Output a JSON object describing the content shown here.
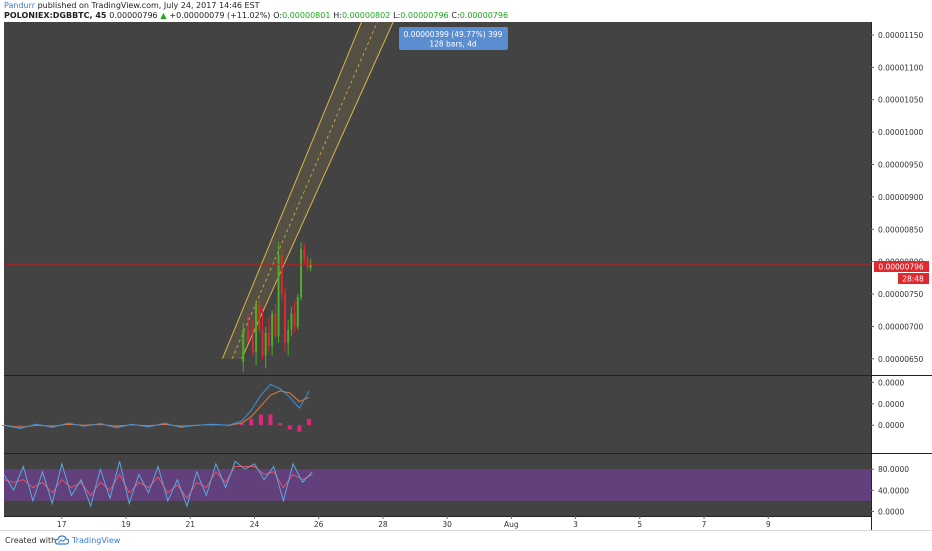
{
  "header": {
    "user": "Pandurr",
    "published": "published on TradingView.com, July 24, 2017 14:46 EST",
    "symbol": "POLONIEX:DGBBTC, 45",
    "last": "0.00000796",
    "change": "+0.00000079 (+11.02%)",
    "o_label": "O:",
    "o_value": "0.00000801",
    "h_label": "H:",
    "h_value": "0.00000802",
    "l_label": "L:",
    "l_value": "0.00000796",
    "c_label": "C:",
    "c_value": "0.00000796"
  },
  "colors": {
    "panel_bg": "#434343",
    "axis_bg": "#ffffff",
    "up": "#4caf24",
    "down": "#e0282e",
    "channel": "#d9b44a",
    "price_line": "#c21f1f",
    "macd": "#3d8fd6",
    "signal": "#e07a3a",
    "hist": "#e0287a",
    "stoch_k": "#5aa8e0",
    "stoch_d": "#e8506a",
    "stoch_band": "#6b3f8f",
    "callout": "#5b8ed1"
  },
  "chart_data": {
    "type": "candlestick",
    "price_axis": {
      "ylim": [
        6.25e-06,
        1.17e-05
      ],
      "ticks": [
        "0.00001150",
        "0.00001100",
        "0.00001050",
        "0.00001000",
        "0.00000950",
        "0.00000900",
        "0.00000850",
        "0.00000800",
        "0.00000750",
        "0.00000700",
        "0.00000650"
      ],
      "tick_values": [
        1.15e-05,
        1.1e-05,
        1.05e-05,
        1e-05,
        9.5e-06,
        9e-06,
        8.5e-06,
        8e-06,
        7.5e-06,
        7e-06,
        6.5e-06
      ],
      "last_price_label": "0.00000796",
      "last_price": 7.96e-06,
      "countdown": "28:48"
    },
    "x_axis": {
      "ticks": [
        "17",
        "19",
        "21",
        "24",
        "26",
        "28",
        "30",
        "Aug",
        "3",
        "5",
        "7",
        "9"
      ],
      "tick_days": [
        17,
        19,
        21,
        23,
        25,
        27,
        29,
        31,
        33,
        35,
        37,
        39
      ],
      "xlim": [
        15.2,
        42.2
      ]
    },
    "callout": {
      "line1": "0.00000399 (49.77%) 399",
      "line2": "128 bars, 4d"
    },
    "channel": {
      "lower_start": [
        22.6,
        6.5e-06
      ],
      "lower_end": [
        27.5,
        1.19e-05
      ],
      "upper_start": [
        22.0,
        6.5e-06
      ],
      "upper_end": [
        26.5,
        1.19e-05
      ],
      "width": 4.7e-07
    },
    "candles": [
      {
        "d": 22.65,
        "o": 6.45,
        "h": 7.05,
        "l": 6.3,
        "c": 6.95
      },
      {
        "d": 22.8,
        "o": 6.95,
        "h": 7.2,
        "l": 6.75,
        "c": 6.8
      },
      {
        "d": 22.95,
        "o": 6.8,
        "h": 7.1,
        "l": 6.55,
        "c": 6.6
      },
      {
        "d": 23.05,
        "o": 6.6,
        "h": 7.4,
        "l": 6.4,
        "c": 7.35
      },
      {
        "d": 23.15,
        "o": 7.35,
        "h": 7.45,
        "l": 6.9,
        "c": 6.95
      },
      {
        "d": 23.25,
        "o": 6.95,
        "h": 7.3,
        "l": 6.5,
        "c": 6.55
      },
      {
        "d": 23.35,
        "o": 6.55,
        "h": 7.0,
        "l": 6.35,
        "c": 6.9
      },
      {
        "d": 23.45,
        "o": 6.9,
        "h": 7.15,
        "l": 6.6,
        "c": 6.7
      },
      {
        "d": 23.55,
        "o": 6.7,
        "h": 7.25,
        "l": 6.55,
        "c": 7.2
      },
      {
        "d": 23.65,
        "o": 7.2,
        "h": 7.35,
        "l": 6.8,
        "c": 6.85
      },
      {
        "d": 23.75,
        "o": 6.85,
        "h": 8.3,
        "l": 6.75,
        "c": 8.1
      },
      {
        "d": 23.85,
        "o": 8.1,
        "h": 8.2,
        "l": 7.4,
        "c": 7.5
      },
      {
        "d": 23.95,
        "o": 7.5,
        "h": 7.6,
        "l": 6.6,
        "c": 6.75
      },
      {
        "d": 24.05,
        "o": 6.75,
        "h": 7.1,
        "l": 6.55,
        "c": 6.95
      },
      {
        "d": 24.15,
        "o": 6.95,
        "h": 7.3,
        "l": 6.85,
        "c": 7.2
      },
      {
        "d": 24.25,
        "o": 7.2,
        "h": 7.4,
        "l": 6.9,
        "c": 7.0
      },
      {
        "d": 24.35,
        "o": 7.0,
        "h": 7.5,
        "l": 6.95,
        "c": 7.45
      },
      {
        "d": 24.45,
        "o": 7.45,
        "h": 8.3,
        "l": 7.4,
        "c": 8.2
      },
      {
        "d": 24.55,
        "o": 8.2,
        "h": 8.28,
        "l": 7.95,
        "c": 8.05
      },
      {
        "d": 24.65,
        "o": 8.05,
        "h": 8.1,
        "l": 7.85,
        "c": 7.9
      },
      {
        "d": 24.75,
        "o": 7.9,
        "h": 8.05,
        "l": 7.85,
        "c": 7.96
      }
    ],
    "macd": {
      "ticks": [
        "0.0000",
        "0.0000",
        "0.0000"
      ],
      "ylim": [
        -1.2,
        2.2
      ],
      "days": [
        15.2,
        15.7,
        16.2,
        16.7,
        17.2,
        17.7,
        18.2,
        18.7,
        19.2,
        19.7,
        20.2,
        20.7,
        21.2,
        21.7,
        22.2,
        22.6,
        22.9,
        23.2,
        23.5,
        23.8,
        24.1,
        24.4,
        24.7
      ],
      "macd_line": [
        0.0,
        -0.15,
        0.05,
        -0.1,
        0.1,
        -0.05,
        0.08,
        -0.12,
        0.05,
        -0.08,
        0.1,
        -0.1,
        0.0,
        0.05,
        0.0,
        0.2,
        0.7,
        1.4,
        1.9,
        1.7,
        1.3,
        0.8,
        1.6
      ],
      "signal_line": [
        0.0,
        -0.1,
        0.0,
        -0.05,
        0.05,
        0.0,
        0.05,
        -0.05,
        0.02,
        -0.03,
        0.05,
        -0.05,
        0.0,
        0.03,
        0.0,
        0.1,
        0.4,
        0.9,
        1.4,
        1.6,
        1.5,
        1.1,
        1.3
      ],
      "histogram": [
        0.0,
        -0.05,
        0.05,
        -0.05,
        0.05,
        -0.05,
        0.03,
        -0.07,
        0.03,
        -0.05,
        0.05,
        -0.05,
        0.0,
        0.02,
        0.0,
        0.1,
        0.3,
        0.5,
        0.5,
        0.1,
        -0.2,
        -0.3,
        0.3
      ]
    },
    "stoch": {
      "ticks": [
        "80.0000",
        "40.0000",
        "0.0000"
      ],
      "tick_values": [
        80,
        40,
        0
      ],
      "ylim": [
        -5,
        105
      ],
      "band": [
        20,
        80
      ],
      "days": [
        15.2,
        15.5,
        15.8,
        16.1,
        16.4,
        16.7,
        17.0,
        17.3,
        17.6,
        17.9,
        18.2,
        18.5,
        18.8,
        19.1,
        19.4,
        19.7,
        20.0,
        20.3,
        20.6,
        20.9,
        21.2,
        21.5,
        21.8,
        22.1,
        22.4,
        22.7,
        23.0,
        23.3,
        23.6,
        23.9,
        24.2,
        24.5,
        24.8
      ],
      "k": [
        70,
        40,
        85,
        20,
        75,
        15,
        90,
        30,
        60,
        10,
        80,
        25,
        95,
        15,
        70,
        35,
        85,
        20,
        60,
        10,
        75,
        30,
        90,
        45,
        95,
        80,
        90,
        60,
        85,
        20,
        90,
        55,
        75
      ],
      "d": [
        60,
        55,
        60,
        45,
        55,
        35,
        60,
        45,
        55,
        30,
        55,
        40,
        70,
        35,
        55,
        45,
        65,
        35,
        50,
        25,
        55,
        45,
        75,
        55,
        85,
        85,
        85,
        70,
        75,
        45,
        70,
        60,
        70
      ]
    }
  },
  "footer": {
    "created_with": "Created with",
    "brand": "TradingView"
  }
}
